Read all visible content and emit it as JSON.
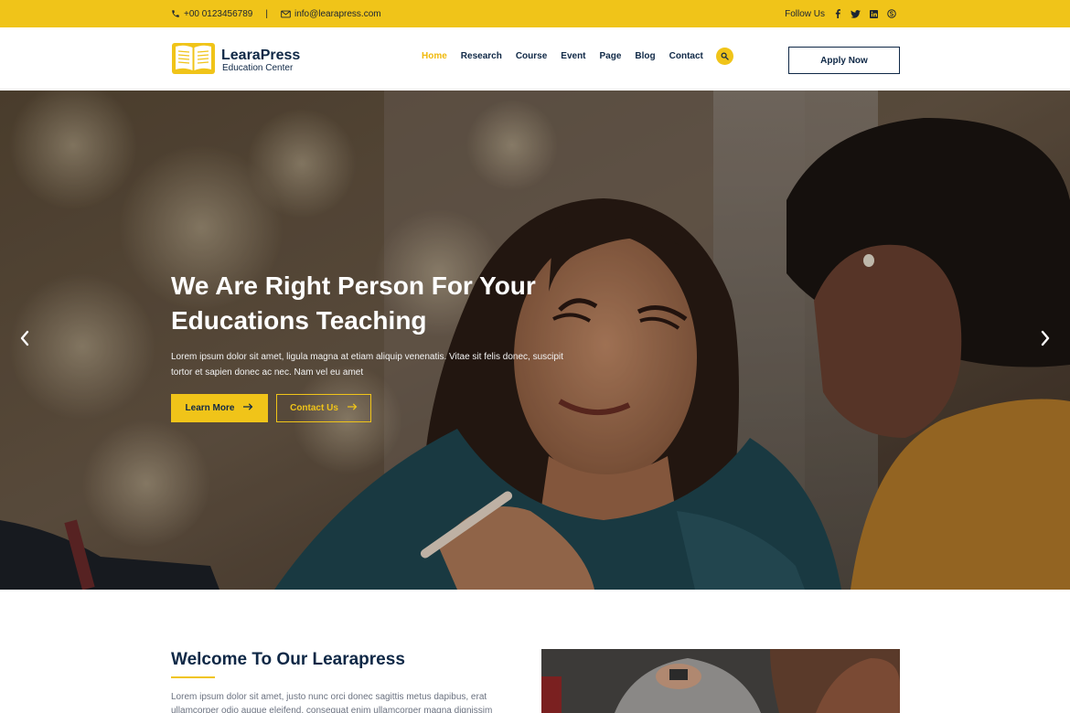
{
  "topbar": {
    "phone": "+00 0123456789",
    "separator": "|",
    "email": "info@learapress.com",
    "follow_label": "Follow Us",
    "social_icons": [
      "facebook-icon",
      "twitter-icon",
      "linkedin-icon",
      "skype-icon"
    ]
  },
  "header": {
    "logo_name": "LearaPress",
    "logo_sub": "Education Center",
    "nav": [
      {
        "label": "Home",
        "active": true
      },
      {
        "label": "Research",
        "active": false
      },
      {
        "label": "Course",
        "active": false
      },
      {
        "label": "Event",
        "active": false
      },
      {
        "label": "Page",
        "active": false
      },
      {
        "label": "Blog",
        "active": false
      },
      {
        "label": "Contact",
        "active": false
      }
    ],
    "apply_label": "Apply Now"
  },
  "hero": {
    "title_line1": "We Are Right Person For Your",
    "title_line2": "Educations Teaching",
    "text": "Lorem ipsum dolor sit amet, ligula magna at etiam aliquip venenatis. Vitae sit felis donec, suscipit tortor et sapien donec ac nec. Nam vel eu amet",
    "learn_more": "Learn More",
    "contact_us": "Contact Us"
  },
  "welcome": {
    "title": "Welcome To Our Learapress",
    "text": "Lorem ipsum dolor sit amet, justo nunc orci donec sagittis metus dapibus, erat ullamcorper odio augue eleifend, consequat enim ullamcorper magna dignissim nec"
  },
  "colors": {
    "accent": "#f0c419",
    "navy": "#0f2846"
  }
}
